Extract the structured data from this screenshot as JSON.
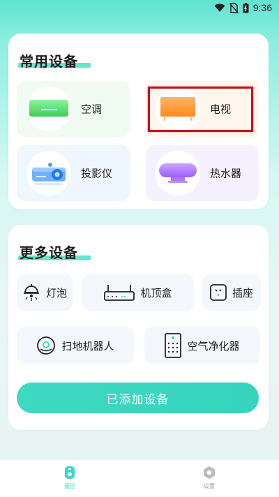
{
  "status_bar": {
    "time": "9:36",
    "icons": [
      "wifi-icon",
      "no-sim-icon",
      "battery-icon"
    ]
  },
  "common_devices": {
    "title": "常用设备",
    "items": [
      {
        "label": "空调",
        "icon": "air-conditioner-icon",
        "bg": "#f1fbf2"
      },
      {
        "label": "电视",
        "icon": "tv-icon",
        "bg": "#fff7ee"
      },
      {
        "label": "投影仪",
        "icon": "projector-icon",
        "bg": "#eef6ff"
      },
      {
        "label": "热水器",
        "icon": "water-heater-icon",
        "bg": "#f6f1ff"
      }
    ]
  },
  "more_devices": {
    "title": "更多设备",
    "items": [
      {
        "label": "灯泡",
        "icon": "light-bulb-icon"
      },
      {
        "label": "机顶盒",
        "icon": "set-top-box-icon"
      },
      {
        "label": "插座",
        "icon": "socket-icon"
      },
      {
        "label": "扫地机器人",
        "icon": "robot-vacuum-icon"
      },
      {
        "label": "空气净化器",
        "icon": "air-purifier-icon"
      }
    ]
  },
  "add_button_label": "已添加设备",
  "tabs": [
    {
      "label": "遥控",
      "icon": "remote-icon",
      "active": true
    },
    {
      "label": "设置",
      "icon": "settings-icon",
      "active": false
    }
  ],
  "colors": {
    "accent": "#3dd8c2",
    "highlight": "#c4121a",
    "inactive": "#b8bcbf"
  }
}
